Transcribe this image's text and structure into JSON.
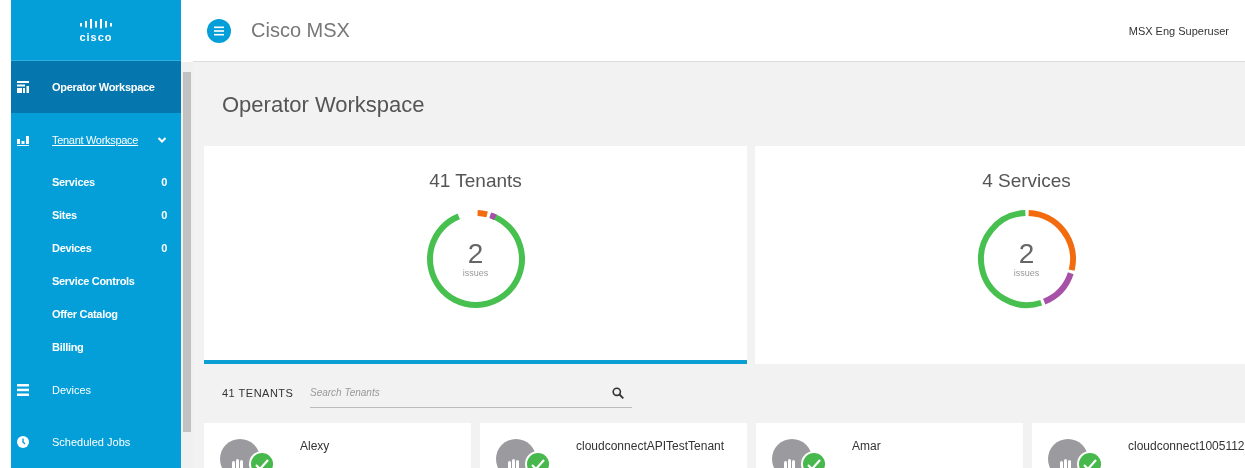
{
  "header": {
    "title": "Cisco MSX",
    "user": "MSX Eng Superuser"
  },
  "sidebar": {
    "logo": "cisco",
    "items": [
      {
        "label": "Operator Workspace",
        "kind": "workspace",
        "selected": true
      },
      {
        "label": "Tenant Workspace",
        "kind": "tenants",
        "selected": false,
        "expanded": true,
        "children": [
          {
            "label": "Services",
            "count": "0",
            "selected": false
          },
          {
            "label": "Sites",
            "count": "0",
            "selected": false
          },
          {
            "label": "Devices",
            "count": "0",
            "selected": false
          },
          {
            "label": "Service Controls",
            "selected": false
          },
          {
            "label": "Offer Catalog",
            "selected": false
          },
          {
            "label": "Billing",
            "selected": false
          }
        ]
      },
      {
        "label": "Devices",
        "kind": "devices",
        "selected": false
      },
      {
        "label": "Scheduled Jobs",
        "kind": "jobs",
        "selected": false
      }
    ]
  },
  "page_title": "Operator Workspace",
  "summary_cards": [
    {
      "title": "41 Tenants",
      "count": "2",
      "count_label": "issues",
      "selected": true
    },
    {
      "title": "4 Services",
      "count": "2",
      "count_label": "issues",
      "selected": false
    }
  ],
  "tenant_bar": {
    "count": "41 TENANTS",
    "search": {
      "placeholder": "Search Tenants"
    }
  },
  "tenants": [
    {
      "name": "Alexy"
    },
    {
      "name": "cloudconnectAPITestTenant"
    },
    {
      "name": "Amar"
    },
    {
      "name": "cloudconnect1005112"
    }
  ]
}
